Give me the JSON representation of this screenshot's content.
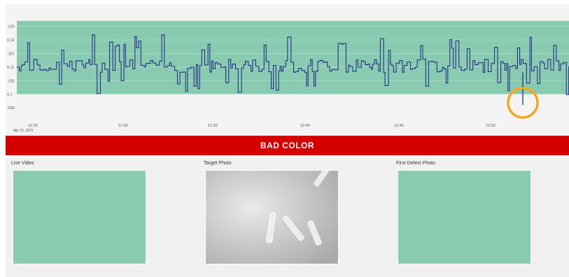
{
  "chart_data": {
    "type": "line",
    "y_ticks": [
      ".125",
      "0.12",
      ".115",
      "0.11",
      ".105",
      "0.1",
      ".095"
    ],
    "y_values": [
      0.125,
      0.12,
      0.115,
      0.11,
      0.105,
      0.1,
      0.095
    ],
    "x_ticks": [
      "12:25",
      "12:30",
      "12:35",
      "12:40",
      "12:45",
      "12:50"
    ],
    "x_date": "Apr 16, 2021",
    "band": [
      0.1,
      0.127
    ],
    "ylim": [
      0.094,
      0.128
    ],
    "xlim": [
      "12:24.5",
      "12:54.8"
    ],
    "series_baseline": 0.11,
    "highlight_value": 0.096,
    "colors": {
      "band": "#88cbb1",
      "line": "#1a237e",
      "highlight": "#f5a623"
    }
  },
  "status": {
    "banner": "BAD COLOR",
    "color": "#d40000"
  },
  "panels": {
    "live_video": "Live Video",
    "target_photo": "Target Photo",
    "first_defect_photo": "First Defect Photo"
  }
}
